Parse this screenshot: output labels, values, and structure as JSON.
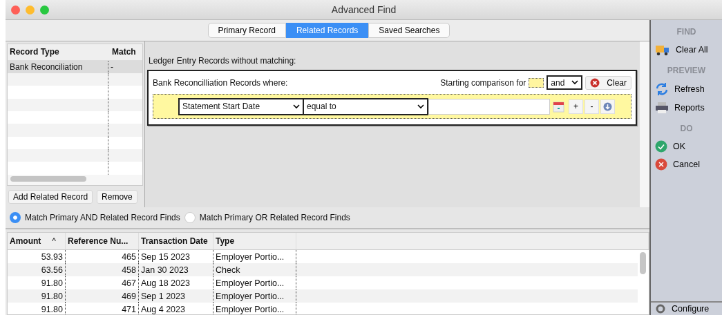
{
  "window": {
    "title": "Advanced Find"
  },
  "tabs": [
    {
      "label": "Primary Record",
      "selected": false
    },
    {
      "label": "Related Records",
      "selected": true
    },
    {
      "label": "Saved Searches",
      "selected": false
    }
  ],
  "record_types": {
    "columns": [
      "Record Type",
      "Match"
    ],
    "rows": [
      {
        "record_type": "Bank Reconciliation",
        "match": "-",
        "selected": true
      }
    ]
  },
  "record_buttons": [
    "Add Related Record",
    "Remove"
  ],
  "criteria": {
    "heading": "Ledger Entry Records without matching:",
    "group_title": "Bank Reconcilliation Records where:",
    "starting_label": "Starting comparison for",
    "conjunction": "and",
    "clear_button": "Clear",
    "field": "Statement Start Date",
    "operator": "equal to",
    "add_button": "+",
    "remove_button": "-"
  },
  "match_options": [
    {
      "label": "Match Primary AND Related Record Finds",
      "selected": true
    },
    {
      "label": "Match Primary OR Related Record Finds",
      "selected": false
    }
  ],
  "results": {
    "columns": [
      {
        "label": "Amount",
        "sort_mark": "^"
      },
      {
        "label": "Reference Nu..."
      },
      {
        "label": "Transaction Date"
      },
      {
        "label": "Type"
      }
    ],
    "rows": [
      [
        "53.93",
        "465",
        "Sep 15 2023",
        "Employer Portio..."
      ],
      [
        "63.56",
        "458",
        "Jan 30 2023",
        "Check"
      ],
      [
        "91.80",
        "467",
        "Aug 18 2023",
        "Employer Portio..."
      ],
      [
        "91.80",
        "469",
        "Sep 1 2023",
        "Employer Portio..."
      ],
      [
        "91.80",
        "471",
        "Aug 4 2023",
        "Employer Portio..."
      ]
    ]
  },
  "sidebar": {
    "sections": [
      {
        "heading": "FIND",
        "items": [
          {
            "label": "Clear All",
            "kind": "truck"
          }
        ]
      },
      {
        "heading": "PREVIEW",
        "items": [
          {
            "label": "Refresh",
            "kind": "refresh"
          },
          {
            "label": "Reports",
            "kind": "printer"
          }
        ]
      },
      {
        "heading": "DO",
        "items": [
          {
            "label": "OK",
            "kind": "ok"
          },
          {
            "label": "Cancel",
            "kind": "cancel"
          }
        ]
      }
    ],
    "footer": {
      "label": "Configure",
      "kind": "gear"
    }
  }
}
